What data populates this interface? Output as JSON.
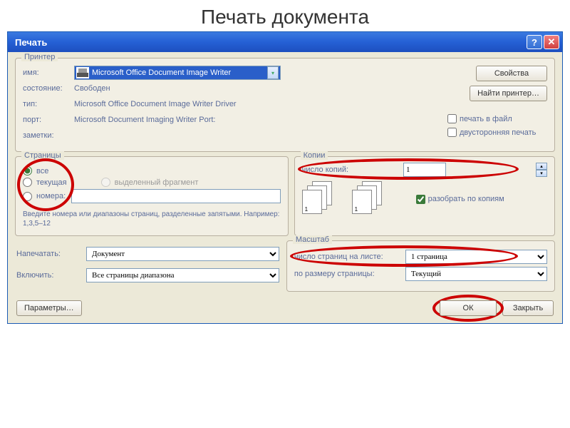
{
  "page_title": "Печать документа",
  "dialog": {
    "title": "Печать"
  },
  "printer": {
    "group_label": "Принтер",
    "name_label": "имя:",
    "name_value": "Microsoft Office Document Image Writer",
    "status_label": "состояние:",
    "status_value": "Свободен",
    "type_label": "тип:",
    "type_value": "Microsoft Office Document Image Writer Driver",
    "port_label": "порт:",
    "port_value": "Microsoft Document Imaging Writer Port:",
    "notes_label": "заметки:",
    "properties_btn": "Свойства",
    "find_printer_btn": "Найти принтер…",
    "print_to_file": "печать в файл",
    "duplex": "двусторонняя печать"
  },
  "pages": {
    "group_label": "Страницы",
    "all": "все",
    "current": "текущая",
    "selection": "выделенный фрагмент",
    "numbers": "номера:",
    "hint": "Введите номера или диапазоны страниц, разделенные запятыми. Например: 1,3,5–12"
  },
  "copies": {
    "group_label": "Копии",
    "count_label": "число копий:",
    "count_value": "1",
    "collate": "разобрать по копиям"
  },
  "print_what": {
    "label": "Напечатать:",
    "value": "Документ"
  },
  "include": {
    "label": "Включить:",
    "value": "Все страницы диапазона"
  },
  "scale": {
    "group_label": "Масштаб",
    "per_sheet_label": "число страниц на листе:",
    "per_sheet_value": "1 страница",
    "fit_label": "по размеру страницы:",
    "fit_value": "Текущий"
  },
  "footer": {
    "options_btn": "Параметры…",
    "ok_btn": "ОК",
    "close_btn": "Закрыть"
  }
}
